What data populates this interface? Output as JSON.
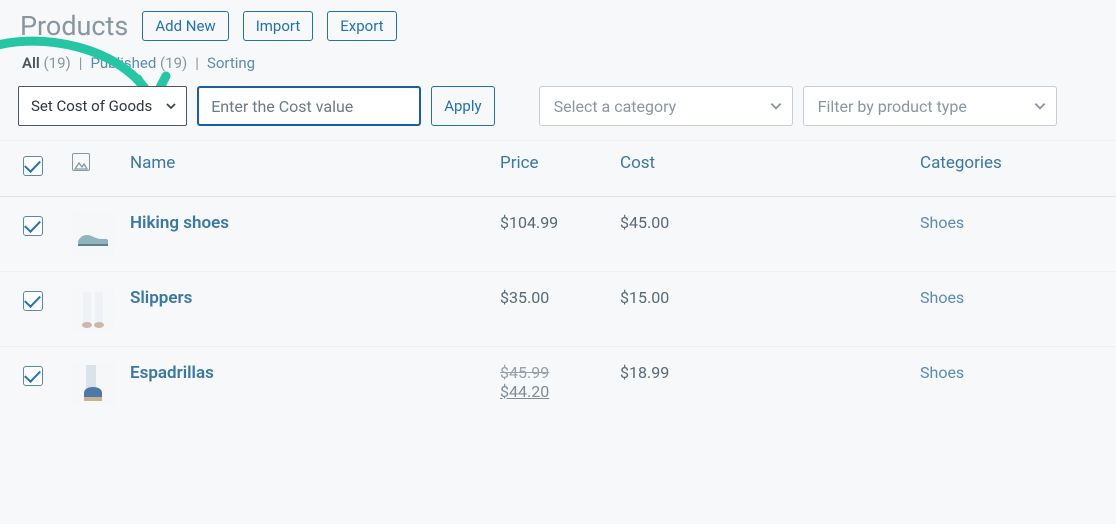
{
  "colors": {
    "accent": "#26c6a5",
    "blue": "#2271b1"
  },
  "header": {
    "title": "Products",
    "add_new": "Add New",
    "import": "Import",
    "export": "Export"
  },
  "filters": {
    "all_label": "All",
    "all_count": "(19)",
    "published_label": "Published",
    "published_count": "(19)",
    "sorting_label": "Sorting"
  },
  "controls": {
    "bulk_action": "Set Cost of Goods",
    "cost_placeholder": "Enter the Cost value",
    "apply": "Apply",
    "category_placeholder": "Select a category",
    "type_placeholder": "Filter by product type"
  },
  "table": {
    "headers": {
      "name": "Name",
      "price": "Price",
      "cost": "Cost",
      "categories": "Categories"
    },
    "rows": [
      {
        "name": "Hiking shoes",
        "price": "$104.99",
        "cost": "$45.00",
        "category": "Shoes"
      },
      {
        "name": "Slippers",
        "price": "$35.00",
        "cost": "$15.00",
        "category": "Shoes"
      },
      {
        "name": "Espadrillas",
        "price_orig": "$45.99",
        "price_sale": "$44.20",
        "cost": "$18.99",
        "category": "Shoes"
      }
    ]
  }
}
